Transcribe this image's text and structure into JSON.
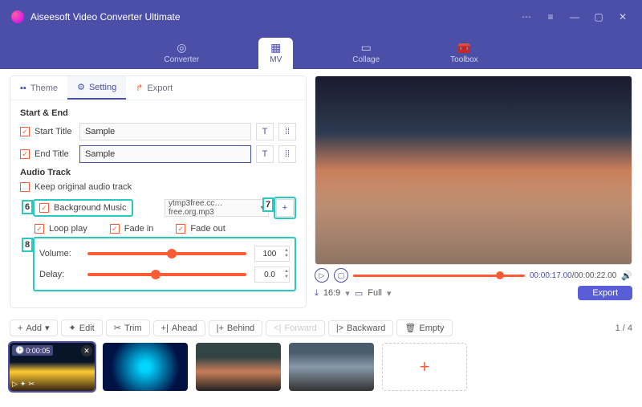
{
  "app": {
    "title": "Aiseesoft Video Converter Ultimate"
  },
  "nav": [
    "Converter",
    "MV",
    "Collage",
    "Toolbox"
  ],
  "tabs": {
    "theme": "Theme",
    "setting": "Setting",
    "export": "Export"
  },
  "sections": {
    "start_end": "Start & End",
    "audio": "Audio Track"
  },
  "fields": {
    "start_title_label": "Start Title",
    "end_title_label": "End Title",
    "start_title_value": "Sample",
    "end_title_value": "Sample",
    "keep_original": "Keep original audio track",
    "background_music": "Background Music",
    "bgm_file": "ytmp3free.cc…free.org.mp3",
    "loop": "Loop play",
    "fade_in": "Fade in",
    "fade_out": "Fade out",
    "volume_label": "Volume:",
    "delay_label": "Delay:",
    "volume_val": "100",
    "delay_val": "0.0"
  },
  "highlight": {
    "six": "6",
    "seven": "7",
    "eight": "8"
  },
  "playback": {
    "current": "00:00:17.00",
    "total": "00:00:22.00",
    "aspect": "16:9",
    "display": "Full",
    "export": "Export"
  },
  "toolbar": {
    "add": "Add",
    "edit": "Edit",
    "trim": "Trim",
    "ahead": "Ahead",
    "behind": "Behind",
    "forward": "Forward",
    "backward": "Backward",
    "empty": "Empty",
    "page": "1 / 4"
  },
  "thumbs": {
    "duration1": "0:00:05"
  },
  "icons": {
    "plus": "+"
  }
}
